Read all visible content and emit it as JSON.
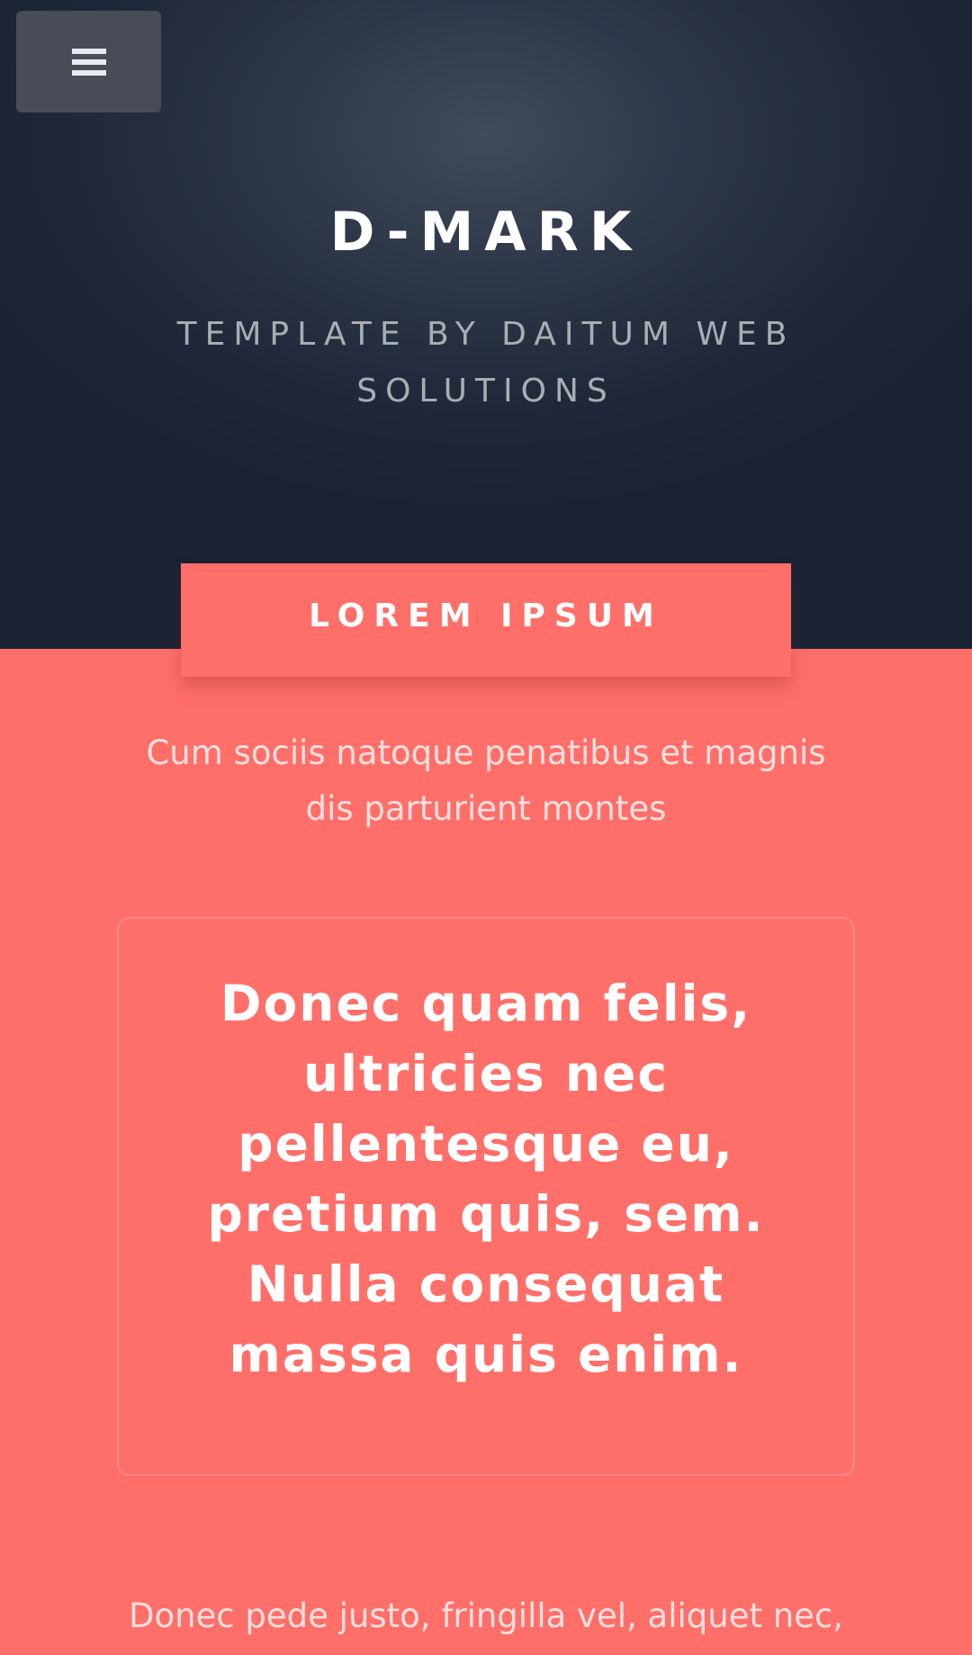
{
  "header": {
    "menu_icon": "hamburger-menu-icon",
    "title": "D-MARK",
    "subtitle": "TEMPLATE BY DAITUM WEB SOLUTIONS"
  },
  "section": {
    "tab_label": "LOREM IPSUM",
    "lead": "Cum sociis natoque penatibus et magnis dis parturient montes",
    "quote": "Donec quam felis, ultricies nec pellentesque eu, pretium quis, sem. Nulla consequat massa quis enim.",
    "footer_text": "Donec pede justo, fringilla vel, aliquet nec,"
  },
  "colors": {
    "hero_bg": "#1f2738",
    "accent": "#ff6f69",
    "menu_button_bg": "#474c57"
  }
}
